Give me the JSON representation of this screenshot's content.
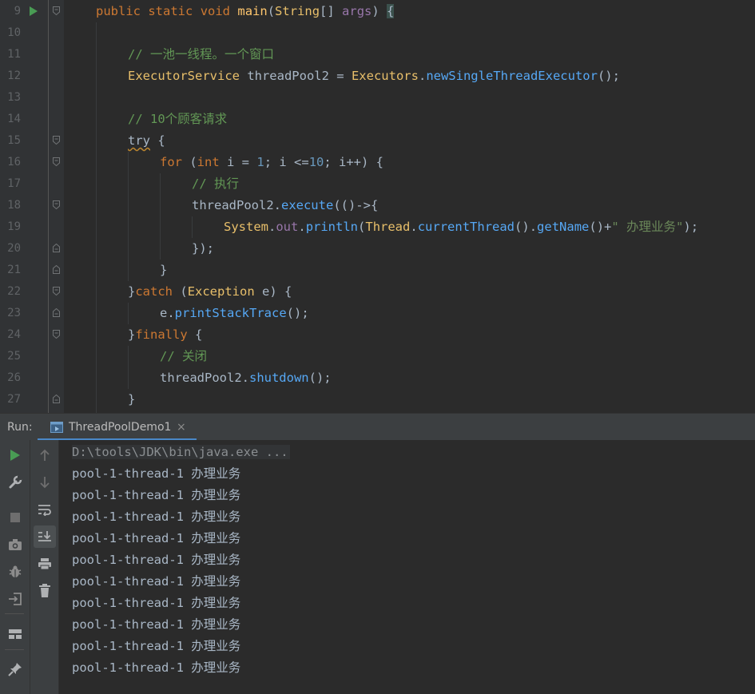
{
  "editor": {
    "lines": [
      {
        "n": "9",
        "tokens": [
          [
            "kw",
            "public"
          ],
          [
            "pu",
            " "
          ],
          [
            "kw",
            "static"
          ],
          [
            "pu",
            " "
          ],
          [
            "kw",
            "void"
          ],
          [
            "pu",
            " "
          ],
          [
            "fn",
            "main"
          ],
          [
            "pu",
            "("
          ],
          [
            "ty",
            "String"
          ],
          [
            "pu",
            "[] "
          ],
          [
            "fd",
            "args"
          ],
          [
            "pu",
            ") "
          ],
          [
            "bracehl",
            "{"
          ]
        ]
      },
      {
        "n": "10",
        "tokens": []
      },
      {
        "n": "11",
        "tokens": [
          [
            "cm",
            "// 一池一线程。一个窗口"
          ]
        ]
      },
      {
        "n": "12",
        "tokens": [
          [
            "ty",
            "ExecutorService"
          ],
          [
            "pu",
            " threadPool2 = "
          ],
          [
            "ty",
            "Executors"
          ],
          [
            "pu",
            "."
          ],
          [
            "mt",
            "newSingleThreadExecutor"
          ],
          [
            "pu",
            "();"
          ]
        ]
      },
      {
        "n": "13",
        "tokens": []
      },
      {
        "n": "14",
        "tokens": [
          [
            "cm",
            "// 10个顾客请求"
          ]
        ]
      },
      {
        "n": "15",
        "tokens": [
          [
            "squig",
            "try"
          ],
          [
            "pu",
            " {"
          ]
        ]
      },
      {
        "n": "16",
        "tokens": [
          [
            "kw",
            "for"
          ],
          [
            "pu",
            " ("
          ],
          [
            "kw",
            "int"
          ],
          [
            "pu",
            " i = "
          ],
          [
            "nu",
            "1"
          ],
          [
            "pu",
            "; i <="
          ],
          [
            "nu",
            "10"
          ],
          [
            "pu",
            "; i++) {"
          ]
        ]
      },
      {
        "n": "17",
        "tokens": [
          [
            "cm",
            "// 执行"
          ]
        ]
      },
      {
        "n": "18",
        "tokens": [
          [
            "pu",
            "threadPool2."
          ],
          [
            "mt",
            "execute"
          ],
          [
            "pu",
            "(()->{"
          ]
        ]
      },
      {
        "n": "19",
        "tokens": [
          [
            "ty",
            "System"
          ],
          [
            "pu",
            "."
          ],
          [
            "fd",
            "out"
          ],
          [
            "pu",
            "."
          ],
          [
            "mt",
            "println"
          ],
          [
            "pu",
            "("
          ],
          [
            "ty",
            "Thread"
          ],
          [
            "pu",
            "."
          ],
          [
            "mt",
            "currentThread"
          ],
          [
            "pu",
            "()."
          ],
          [
            "mt",
            "getName"
          ],
          [
            "pu",
            "()+"
          ],
          [
            "st",
            "\" 办理业务\""
          ],
          [
            "pu",
            ");"
          ]
        ]
      },
      {
        "n": "20",
        "tokens": [
          [
            "pu",
            "});"
          ]
        ]
      },
      {
        "n": "21",
        "tokens": [
          [
            "pu",
            "}"
          ]
        ]
      },
      {
        "n": "22",
        "tokens": [
          [
            "pu",
            "}"
          ],
          [
            "kw",
            "catch"
          ],
          [
            "pu",
            " ("
          ],
          [
            "ty",
            "Exception"
          ],
          [
            "pu",
            " e) {"
          ]
        ]
      },
      {
        "n": "23",
        "tokens": [
          [
            "pu",
            "e."
          ],
          [
            "mt",
            "printStackTrace"
          ],
          [
            "pu",
            "();"
          ]
        ]
      },
      {
        "n": "24",
        "tokens": [
          [
            "pu",
            "}"
          ],
          [
            "kw",
            "finally"
          ],
          [
            "pu",
            " {"
          ]
        ]
      },
      {
        "n": "25",
        "tokens": [
          [
            "cm",
            "// 关闭"
          ]
        ]
      },
      {
        "n": "26",
        "tokens": [
          [
            "pu",
            "threadPool2."
          ],
          [
            "mt",
            "shutdown"
          ],
          [
            "pu",
            "();"
          ]
        ]
      },
      {
        "n": "27",
        "tokens": [
          [
            "pu",
            "}"
          ]
        ]
      }
    ]
  },
  "run": {
    "label": "Run:",
    "tab_label": "ThreadPoolDemo1",
    "tab_close": "×"
  },
  "console": {
    "command": "D:\\tools\\JDK\\bin\\java.exe ...",
    "output": [
      "pool-1-thread-1 办理业务",
      "pool-1-thread-1 办理业务",
      "pool-1-thread-1 办理业务",
      "pool-1-thread-1 办理业务",
      "pool-1-thread-1 办理业务",
      "pool-1-thread-1 办理业务",
      "pool-1-thread-1 办理业务",
      "pool-1-thread-1 办理业务",
      "pool-1-thread-1 办理业务",
      "pool-1-thread-1 办理业务"
    ]
  },
  "toolbar_icons": {
    "col1": [
      "run-icon",
      "wrench-icon",
      "stop-icon",
      "camera-icon",
      "bug-icon",
      "exit-icon",
      "layout-icon",
      "pin-icon"
    ],
    "col2": [
      "arrow-up-icon",
      "arrow-down-icon",
      "soft-wrap-icon",
      "scroll-to-end-icon",
      "print-icon",
      "trash-icon"
    ]
  },
  "colors": {
    "background": "#2b2b2b",
    "gutter": "#313335",
    "panel": "#3c3f41",
    "keyword": "#cc7832",
    "method": "#56a8f5",
    "comment": "#629755",
    "number": "#6897bb",
    "string": "#6a8759",
    "field": "#9876aa",
    "run_green": "#499c54",
    "tab_accent": "#4a88c7"
  }
}
